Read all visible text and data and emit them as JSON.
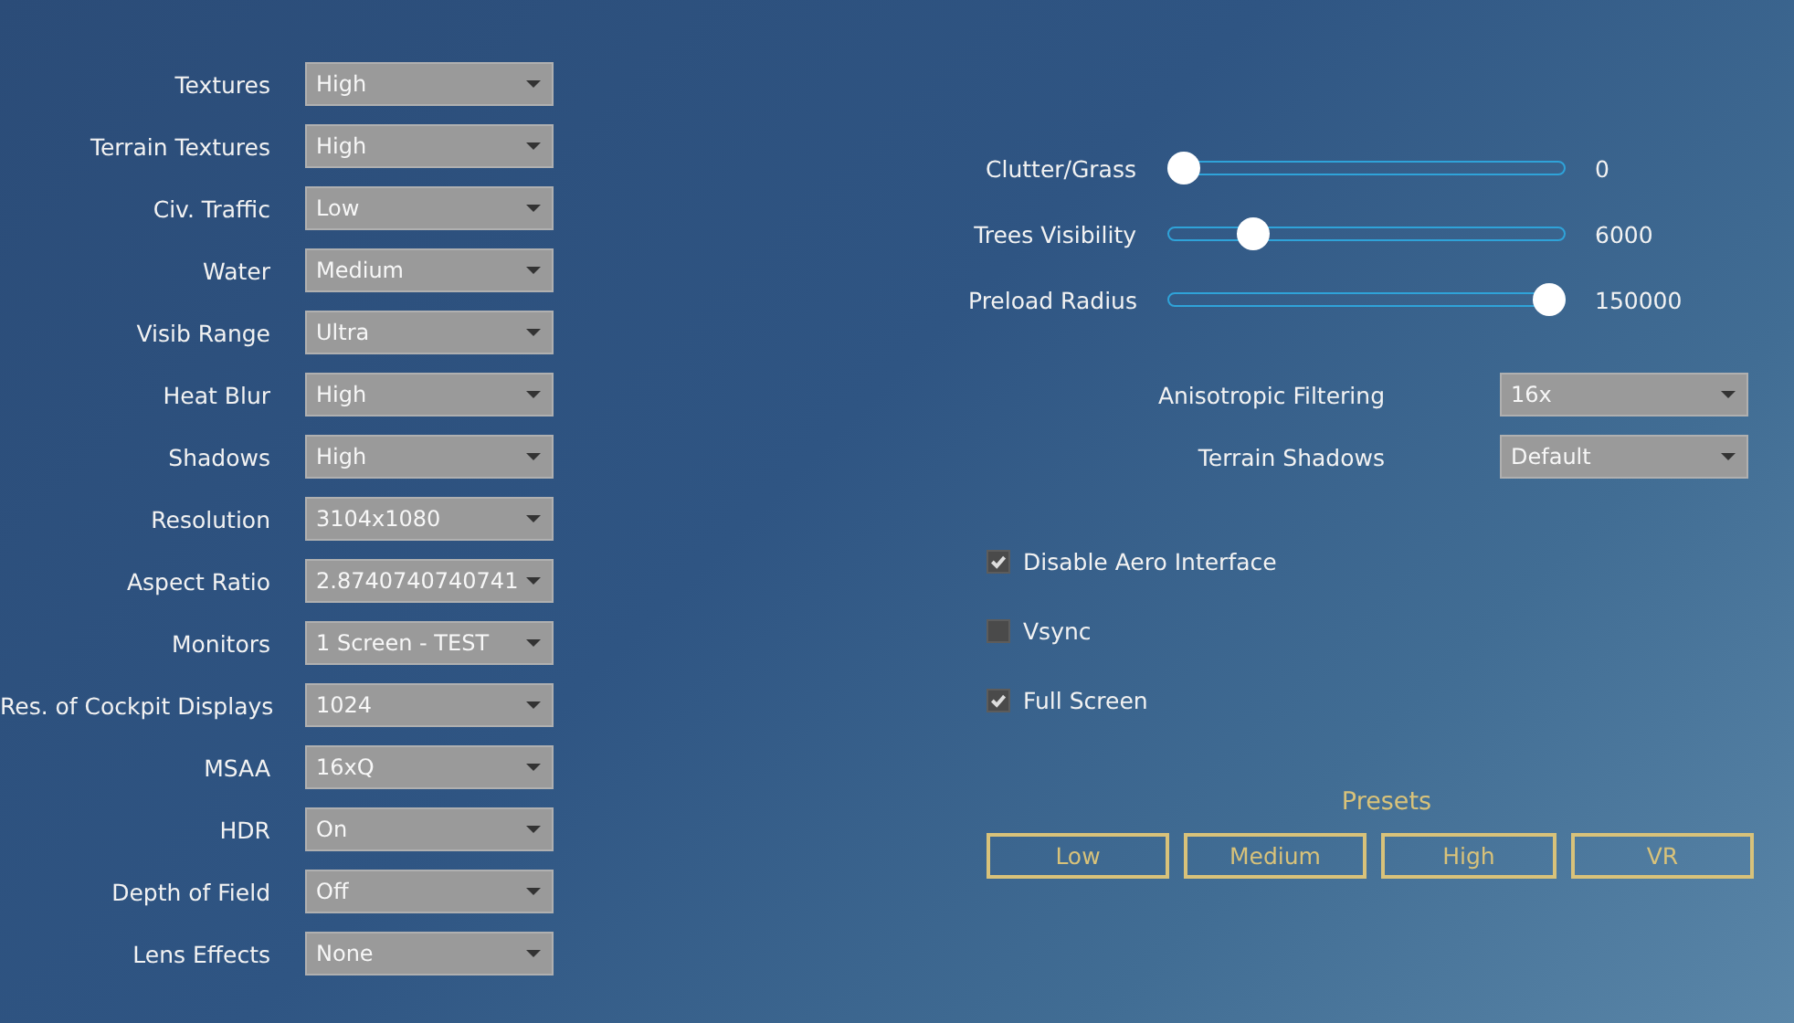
{
  "dropdowns": [
    {
      "label": "Textures",
      "value": "High"
    },
    {
      "label": "Terrain Textures",
      "value": "High"
    },
    {
      "label": "Civ. Traffic",
      "value": "Low"
    },
    {
      "label": "Water",
      "value": "Medium"
    },
    {
      "label": "Visib Range",
      "value": "Ultra"
    },
    {
      "label": "Heat Blur",
      "value": "High"
    },
    {
      "label": "Shadows",
      "value": "High"
    },
    {
      "label": "Resolution",
      "value": "3104x1080"
    },
    {
      "label": "Aspect Ratio",
      "value": "2.8740740740741"
    },
    {
      "label": "Monitors",
      "value": "1 Screen - TEST"
    },
    {
      "label": "Res. of Cockpit Displays",
      "value": "1024"
    },
    {
      "label": "MSAA",
      "value": "16xQ"
    },
    {
      "label": "HDR",
      "value": "On"
    },
    {
      "label": "Depth of Field",
      "value": "Off"
    },
    {
      "label": "Lens Effects",
      "value": "None"
    }
  ],
  "sliders": [
    {
      "label": "Clutter/Grass",
      "level": 0,
      "reading": "0"
    },
    {
      "label": "Trees Visibility",
      "level": 0.19,
      "reading": "6000"
    },
    {
      "label": "Preload Radius",
      "level": 1,
      "reading": "150000"
    }
  ],
  "right_dropdowns": [
    {
      "label": "Anisotropic Filtering",
      "value": "16x"
    },
    {
      "label": "Terrain Shadows",
      "value": "Default"
    }
  ],
  "checkboxes": [
    {
      "label": "Disable Aero Interface",
      "checked": true
    },
    {
      "label": "Vsync",
      "checked": false
    },
    {
      "label": "Full Screen",
      "checked": true
    }
  ],
  "presets": {
    "title": "Presets",
    "buttons": [
      "Low",
      "Medium",
      "High",
      "VR"
    ]
  }
}
